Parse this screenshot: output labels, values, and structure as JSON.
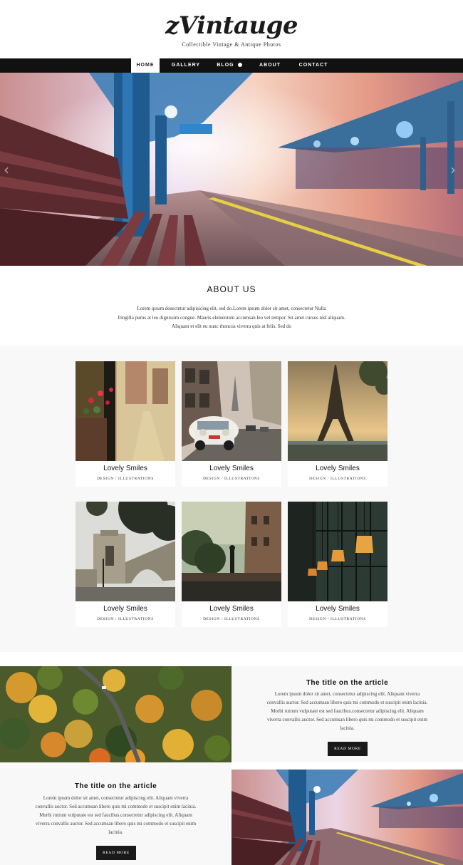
{
  "brand": {
    "logo": "zVintauge",
    "tagline": "Collectible Vintage & Antique Photos"
  },
  "nav": {
    "items": [
      {
        "label": "HOME",
        "active": true
      },
      {
        "label": "GALLERY",
        "active": false
      },
      {
        "label": "BLOG",
        "active": false,
        "icon": "plus-circle-icon"
      },
      {
        "label": "ABOUT",
        "active": false
      },
      {
        "label": "CONTACT",
        "active": false
      }
    ]
  },
  "hero": {
    "prev_icon": "chevron-left-icon",
    "next_icon": "chevron-right-icon"
  },
  "about": {
    "title": "ABOUT US",
    "lines": [
      "Lorem ipsum dosectetur adipisicing elit, sed do.Lorem ipsum dolor sit amet, consectetur Nulla",
      "fringilla purus at leo dignissim congue. Mauris elementum accumsan leo vel tempor. Sit amet cursus nisl aliquam.",
      "Aliquam et elit eu nunc rhoncus viverra quis at felis. Sed do"
    ]
  },
  "gallery": {
    "items": [
      {
        "title": "Lovely Smiles",
        "category": "DESIGN / ILLUSTRATIONS"
      },
      {
        "title": "Lovely Smiles",
        "category": "DESIGN / ILLUSTRATIONS"
      },
      {
        "title": "Lovely Smiles",
        "category": "DESIGN / ILLUSTRATIONS"
      },
      {
        "title": "Lovely Smiles",
        "category": "DESIGN / ILLUSTRATIONS"
      },
      {
        "title": "Lovely Smiles",
        "category": "DESIGN / ILLUSTRATIONS"
      },
      {
        "title": "Lovely Smiles",
        "category": "DESIGN / ILLUSTRATIONS"
      }
    ]
  },
  "articles": [
    {
      "title": "The title on the article",
      "lines": [
        "Lorem ipsum dolor sit amet, consectetur adipiscing elit. Aliquam viverra",
        "convallis auctor. Sed accumsan libero quis mi commodo et suscipit enim lacinia.",
        "Morbi rutrum vulputate est sed faucibus.consectetur adipiscing elit. Aliquam",
        "viverra convallis auctor. Sed accumsan libero quis mi commodo et suscipit enim",
        "lacinia."
      ],
      "button": "READ MORE"
    },
    {
      "title": "The title on the article",
      "lines": [
        "Lorem ipsum dolor sit amet, consectetur adipiscing elit. Aliquam viverra",
        "convallis auctor. Sed accumsan libero quis mi commodo et suscipit enim lacinia.",
        "Morbi rutrum vulputate est sed faucibus.consectetur adipiscing elit. Aliquam",
        "viverra convallis auctor. Sed accumsan libero quis mi commodo et suscipit enim",
        "lacinia."
      ],
      "button": "READ MORE"
    }
  ],
  "colors": {
    "nav_bg": "#111111",
    "section_bg": "#f8f8f8",
    "button_bg": "#1a1a1a"
  }
}
